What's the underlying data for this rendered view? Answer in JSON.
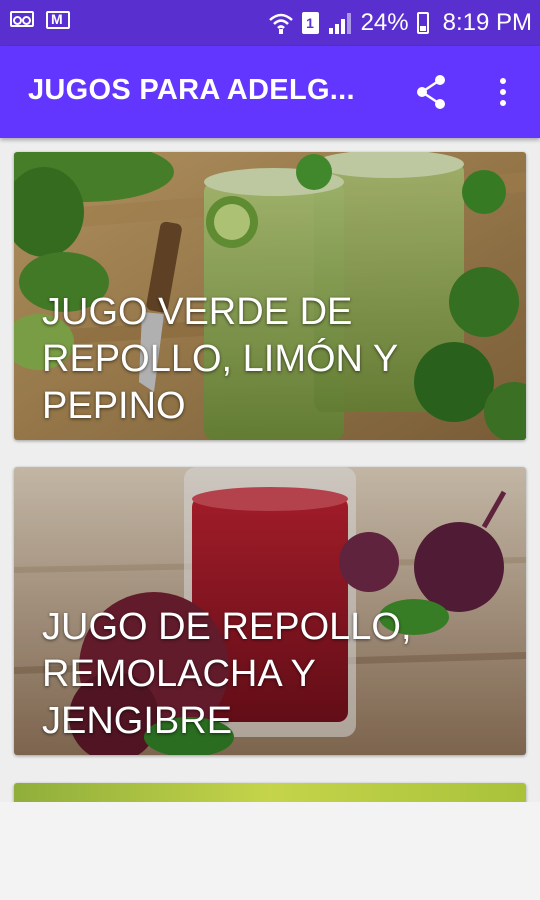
{
  "status_bar": {
    "battery_percent": "24%",
    "time": "8:19 PM",
    "sim_slot": "1",
    "icons": [
      "voicemail-icon",
      "gmail-icon",
      "wifi-calling-icon",
      "sim-icon",
      "signal-icon",
      "battery-icon"
    ]
  },
  "app_bar": {
    "title": "JUGOS PARA ADELG...",
    "actions": [
      "share-icon",
      "more-vert-icon"
    ],
    "color": "#6236ff"
  },
  "cards": [
    {
      "caption": "JUGO VERDE DE REPOLLO, LIMÓN Y PEPINO"
    },
    {
      "caption": "JUGO DE REPOLLO, REMOLACHA Y JENGIBRE"
    }
  ]
}
